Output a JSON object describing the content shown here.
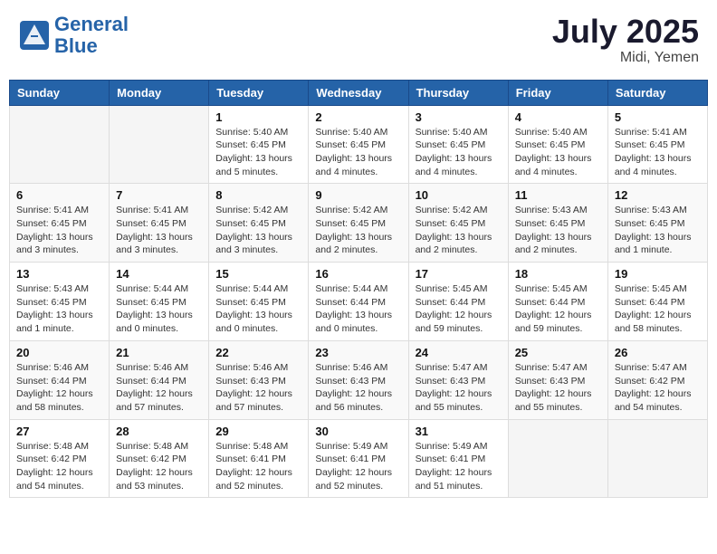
{
  "header": {
    "logo_line1": "General",
    "logo_line2": "Blue",
    "month_title": "July 2025",
    "location": "Midi, Yemen"
  },
  "weekdays": [
    "Sunday",
    "Monday",
    "Tuesday",
    "Wednesday",
    "Thursday",
    "Friday",
    "Saturday"
  ],
  "weeks": [
    [
      {
        "day": "",
        "info": ""
      },
      {
        "day": "",
        "info": ""
      },
      {
        "day": "1",
        "info": "Sunrise: 5:40 AM\nSunset: 6:45 PM\nDaylight: 13 hours and 5 minutes."
      },
      {
        "day": "2",
        "info": "Sunrise: 5:40 AM\nSunset: 6:45 PM\nDaylight: 13 hours and 4 minutes."
      },
      {
        "day": "3",
        "info": "Sunrise: 5:40 AM\nSunset: 6:45 PM\nDaylight: 13 hours and 4 minutes."
      },
      {
        "day": "4",
        "info": "Sunrise: 5:40 AM\nSunset: 6:45 PM\nDaylight: 13 hours and 4 minutes."
      },
      {
        "day": "5",
        "info": "Sunrise: 5:41 AM\nSunset: 6:45 PM\nDaylight: 13 hours and 4 minutes."
      }
    ],
    [
      {
        "day": "6",
        "info": "Sunrise: 5:41 AM\nSunset: 6:45 PM\nDaylight: 13 hours and 3 minutes."
      },
      {
        "day": "7",
        "info": "Sunrise: 5:41 AM\nSunset: 6:45 PM\nDaylight: 13 hours and 3 minutes."
      },
      {
        "day": "8",
        "info": "Sunrise: 5:42 AM\nSunset: 6:45 PM\nDaylight: 13 hours and 3 minutes."
      },
      {
        "day": "9",
        "info": "Sunrise: 5:42 AM\nSunset: 6:45 PM\nDaylight: 13 hours and 2 minutes."
      },
      {
        "day": "10",
        "info": "Sunrise: 5:42 AM\nSunset: 6:45 PM\nDaylight: 13 hours and 2 minutes."
      },
      {
        "day": "11",
        "info": "Sunrise: 5:43 AM\nSunset: 6:45 PM\nDaylight: 13 hours and 2 minutes."
      },
      {
        "day": "12",
        "info": "Sunrise: 5:43 AM\nSunset: 6:45 PM\nDaylight: 13 hours and 1 minute."
      }
    ],
    [
      {
        "day": "13",
        "info": "Sunrise: 5:43 AM\nSunset: 6:45 PM\nDaylight: 13 hours and 1 minute."
      },
      {
        "day": "14",
        "info": "Sunrise: 5:44 AM\nSunset: 6:45 PM\nDaylight: 13 hours and 0 minutes."
      },
      {
        "day": "15",
        "info": "Sunrise: 5:44 AM\nSunset: 6:45 PM\nDaylight: 13 hours and 0 minutes."
      },
      {
        "day": "16",
        "info": "Sunrise: 5:44 AM\nSunset: 6:44 PM\nDaylight: 13 hours and 0 minutes."
      },
      {
        "day": "17",
        "info": "Sunrise: 5:45 AM\nSunset: 6:44 PM\nDaylight: 12 hours and 59 minutes."
      },
      {
        "day": "18",
        "info": "Sunrise: 5:45 AM\nSunset: 6:44 PM\nDaylight: 12 hours and 59 minutes."
      },
      {
        "day": "19",
        "info": "Sunrise: 5:45 AM\nSunset: 6:44 PM\nDaylight: 12 hours and 58 minutes."
      }
    ],
    [
      {
        "day": "20",
        "info": "Sunrise: 5:46 AM\nSunset: 6:44 PM\nDaylight: 12 hours and 58 minutes."
      },
      {
        "day": "21",
        "info": "Sunrise: 5:46 AM\nSunset: 6:44 PM\nDaylight: 12 hours and 57 minutes."
      },
      {
        "day": "22",
        "info": "Sunrise: 5:46 AM\nSunset: 6:43 PM\nDaylight: 12 hours and 57 minutes."
      },
      {
        "day": "23",
        "info": "Sunrise: 5:46 AM\nSunset: 6:43 PM\nDaylight: 12 hours and 56 minutes."
      },
      {
        "day": "24",
        "info": "Sunrise: 5:47 AM\nSunset: 6:43 PM\nDaylight: 12 hours and 55 minutes."
      },
      {
        "day": "25",
        "info": "Sunrise: 5:47 AM\nSunset: 6:43 PM\nDaylight: 12 hours and 55 minutes."
      },
      {
        "day": "26",
        "info": "Sunrise: 5:47 AM\nSunset: 6:42 PM\nDaylight: 12 hours and 54 minutes."
      }
    ],
    [
      {
        "day": "27",
        "info": "Sunrise: 5:48 AM\nSunset: 6:42 PM\nDaylight: 12 hours and 54 minutes."
      },
      {
        "day": "28",
        "info": "Sunrise: 5:48 AM\nSunset: 6:42 PM\nDaylight: 12 hours and 53 minutes."
      },
      {
        "day": "29",
        "info": "Sunrise: 5:48 AM\nSunset: 6:41 PM\nDaylight: 12 hours and 52 minutes."
      },
      {
        "day": "30",
        "info": "Sunrise: 5:49 AM\nSunset: 6:41 PM\nDaylight: 12 hours and 52 minutes."
      },
      {
        "day": "31",
        "info": "Sunrise: 5:49 AM\nSunset: 6:41 PM\nDaylight: 12 hours and 51 minutes."
      },
      {
        "day": "",
        "info": ""
      },
      {
        "day": "",
        "info": ""
      }
    ]
  ]
}
